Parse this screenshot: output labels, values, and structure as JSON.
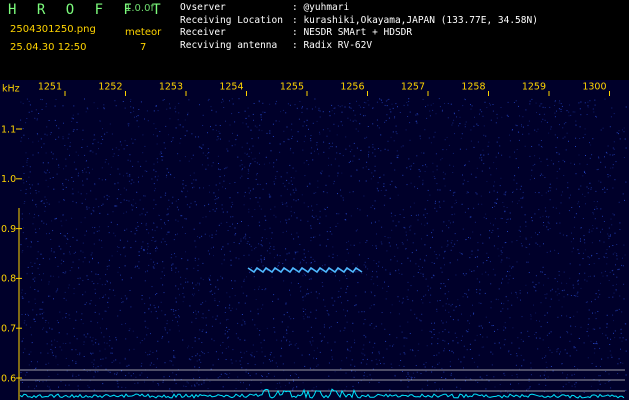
{
  "header": {
    "app_title": "H R O F F T",
    "version": "1.0.0f",
    "filename": "2504301250.png",
    "datetime": "25.04.30 12:50",
    "meteor_label": "meteor",
    "meteor_count": "7",
    "meta": [
      {
        "key": "Ovserver",
        "value": ": @yuhmari"
      },
      {
        "key": "Receiving Location",
        "value": ": kurashiki,Okayama,JAPAN (133.77E, 34.58N)"
      },
      {
        "key": "Receiver",
        "value": ": NESDR SMArt + HDSDR"
      },
      {
        "key": "Recviving antenna",
        "value": ": Radix RV-62V"
      }
    ]
  },
  "spectrogram": {
    "freq_unit": "kHz",
    "time_ticks": [
      "1251",
      "1252",
      "1253",
      "1254",
      "1255",
      "1256",
      "1257",
      "1258",
      "1259",
      "1300"
    ],
    "freq_ticks": [
      "1.1",
      "1.0",
      "0.9",
      "0.8",
      "0.7",
      "0.6"
    ],
    "background_color": "#00002a",
    "noise_color": "#2a4dd8",
    "trace_color": "#4fb8ff",
    "baseline_color": "#00e5ff"
  }
}
